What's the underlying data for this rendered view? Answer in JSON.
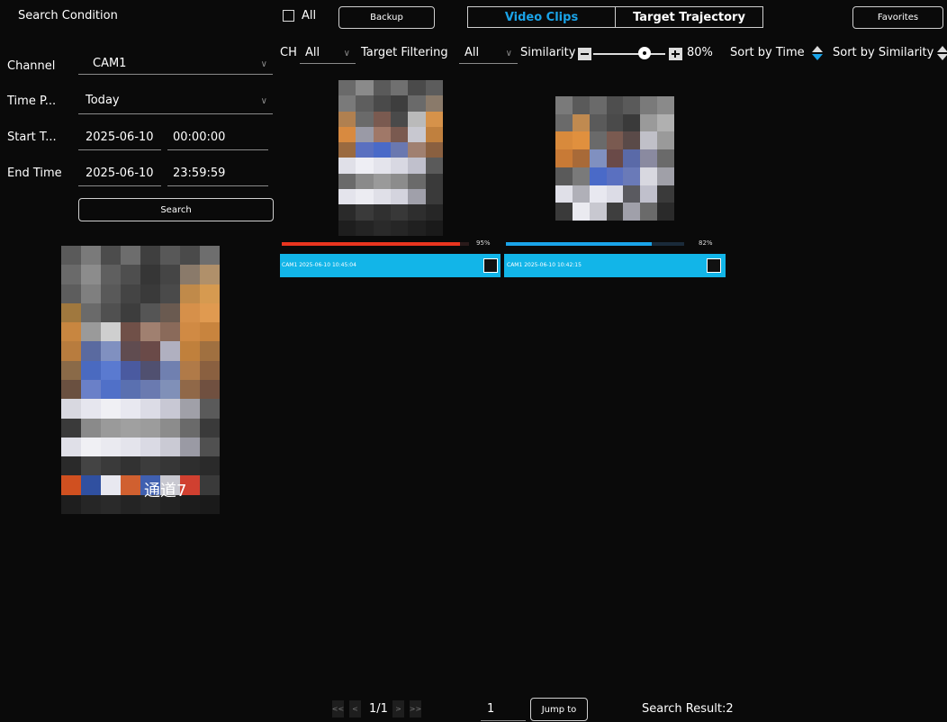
{
  "left": {
    "title": "Search Condition",
    "channel_label": "Channel",
    "channel_value": "CAM1",
    "time_period_label": "Time P...",
    "time_period_value": "Today",
    "start_label": "Start T...",
    "start_date": "2025-06-10",
    "start_time": "00:00:00",
    "end_label": "End Time",
    "end_date": "2025-06-10",
    "end_time": "23:59:59",
    "search_button": "Search",
    "preview_caption": "通道7"
  },
  "toolbar": {
    "all_label": "All",
    "backup_button": "Backup",
    "tab_video": "Video Clips",
    "tab_trajectory": "Target Trajectory",
    "favorites_button": "Favorites"
  },
  "filters": {
    "ch_label": "CH",
    "ch_value": "All",
    "target_label": "Target Filtering",
    "target_value": "All",
    "similarity_label": "Similarity",
    "similarity_value": "80%",
    "similarity_level": 0.8,
    "sort_time": "Sort by Time",
    "sort_similarity": "Sort by Similarity"
  },
  "results": [
    {
      "percent": "95%",
      "level": 0.95,
      "bar_color": "#e8351f",
      "caption": "CAM1 2025-06-10 10:45:04"
    },
    {
      "percent": "82%",
      "level": 0.82,
      "bar_color": "#1aa3e8",
      "caption": "CAM1 2025-06-10 10:42:15"
    }
  ],
  "pagination": {
    "first": "<<",
    "prev": "<",
    "page_info": "1/1",
    "next": ">",
    "last": ">>",
    "jump_value": "1",
    "jump_button": "Jump to",
    "result_text": "Search Result:2"
  },
  "colors": {
    "accent": "#1aa3e8",
    "selected_caption_bg": "#12b5e8",
    "danger": "#e8351f"
  }
}
